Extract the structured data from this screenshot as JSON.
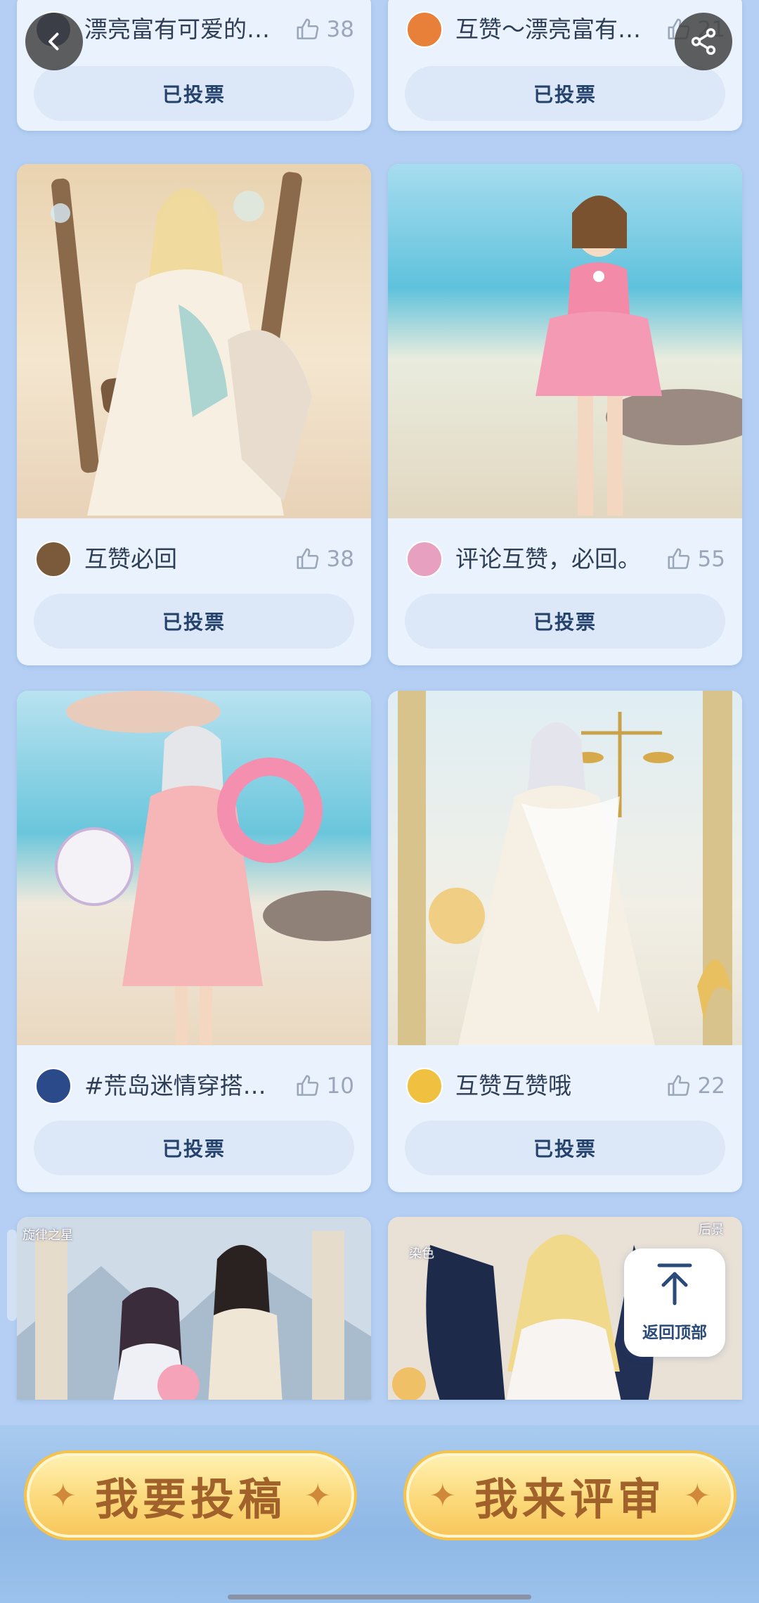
{
  "controls": {
    "back_icon": "chevron-left-icon",
    "share_icon": "share-icon",
    "back_to_top_label": "返回顶部",
    "back_to_top_icon": "arrow-up-bar-icon"
  },
  "vote_label": "已投票",
  "entries": [
    {
      "name": "漂亮富有可爱的…",
      "likes": "38",
      "avatar_color": "#3a4a7a"
    },
    {
      "name": "互赞～漂亮富有…",
      "likes": "21",
      "avatar_color": "#e8803a"
    },
    {
      "name": "互赞必回",
      "likes": "38",
      "avatar_color": "#7a5a3a"
    },
    {
      "name": "评论互赞，必回。",
      "likes": "55",
      "avatar_color": "#e8a0c0"
    },
    {
      "name": "#荒岛迷情穿搭…",
      "likes": "10",
      "avatar_color": "#2a4a8a"
    },
    {
      "name": "互赞互赞哦",
      "likes": "22",
      "avatar_color": "#f0c040"
    }
  ],
  "partial_cards": [
    {
      "overlay_text": "旋律之星"
    },
    {
      "overlay_text_left": "染色",
      "overlay_text_right": "后景"
    }
  ],
  "actions": {
    "submit_label": "我要投稿",
    "review_label": "我来评审"
  },
  "colors": {
    "background": "#b4cff3",
    "card": "#eaf2fd",
    "vote_button": "#dce8f7",
    "accent_gold": "#fcd97a",
    "accent_brown": "#a0622a"
  }
}
